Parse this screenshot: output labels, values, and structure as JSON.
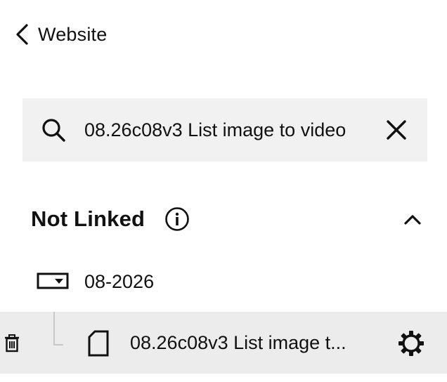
{
  "nav": {
    "back_label": "Website",
    "back_icon": "chevron-left-icon"
  },
  "search": {
    "value": "08.26c08v3 List image to video",
    "placeholder": "Search",
    "search_icon": "search-icon",
    "clear_icon": "close-icon"
  },
  "section": {
    "title": "Not Linked",
    "info_icon": "info-icon",
    "collapse_icon": "chevron-up-icon"
  },
  "tree": {
    "folder": {
      "label": "08-2026",
      "icon": "folder-dropdown-icon"
    },
    "page": {
      "label": "08.26c08v3 List image t...",
      "icon": "page-icon",
      "trash_icon": "trash-icon",
      "settings_icon": "gear-icon",
      "selected": true
    }
  },
  "colors": {
    "text": "#111111",
    "search_bg": "#f1f1f1",
    "selected_row_bg": "#ececec",
    "tree_line": "#c8c8c8"
  }
}
